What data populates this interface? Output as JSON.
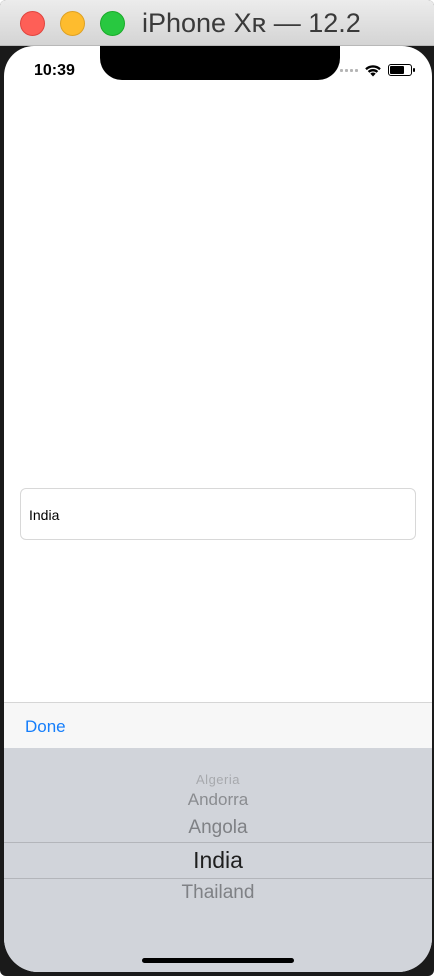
{
  "window": {
    "title": "iPhone Xʀ — 12.2"
  },
  "status_bar": {
    "time": "10:39",
    "battery_level": 0.7
  },
  "text_field": {
    "value": "India"
  },
  "toolbar": {
    "done_label": "Done",
    "accent_color": "#157efb"
  },
  "picker": {
    "options": [
      "Algeria",
      "Andorra",
      "Angola",
      "India",
      "Thailand"
    ],
    "selected": "India"
  },
  "icons": [
    "cellular-signal-icon",
    "wifi-icon",
    "battery-icon"
  ]
}
